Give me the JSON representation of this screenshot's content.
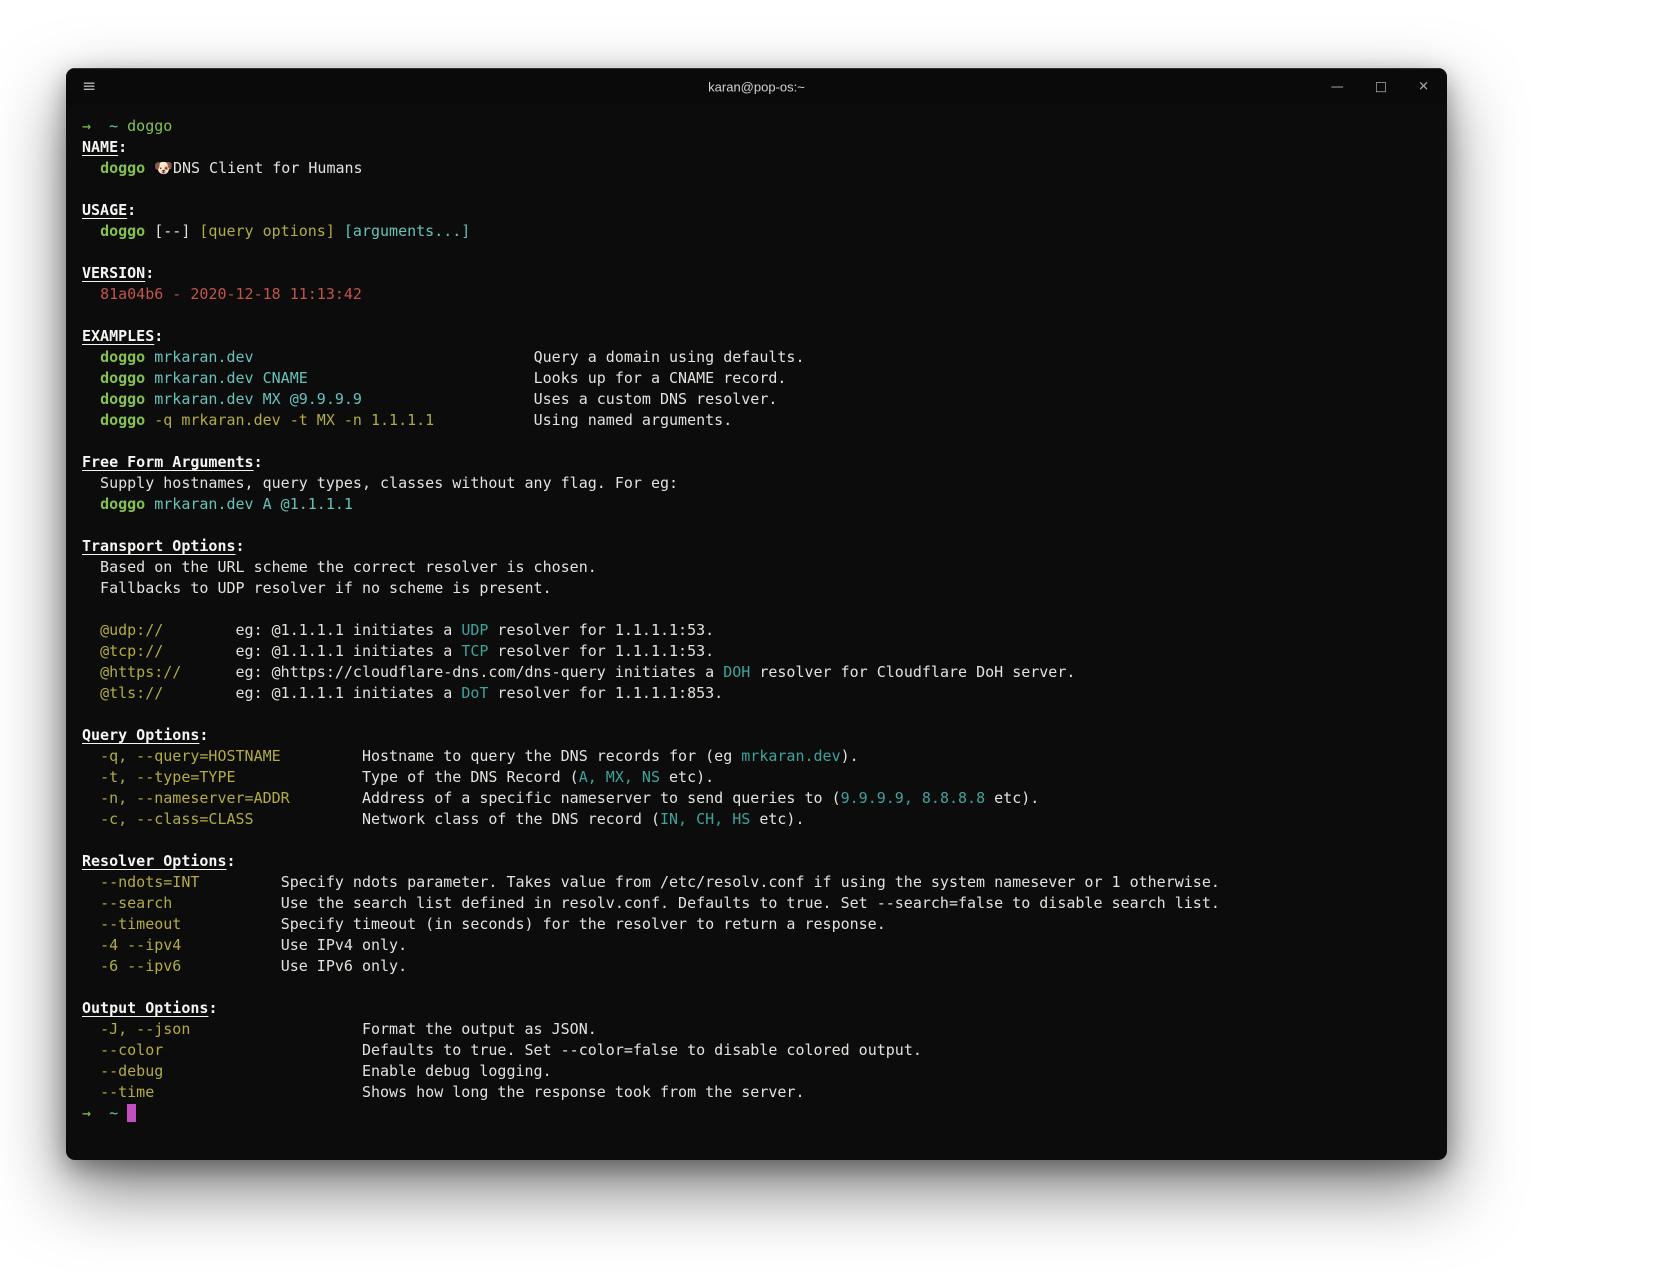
{
  "palette": {
    "bg": "#0b0c0b",
    "titlebar": "#0a0a0a",
    "g": "#84c052",
    "c": "#66c2bb",
    "t": "#3fa39b",
    "y": "#b3ac42",
    "r": "#c2544b",
    "w": "#e2e2de",
    "wb": "#f5f5f2",
    "cur": "#c050c0"
  },
  "window": {
    "title": "karan@pop-os:~",
    "menu_icon": "≡",
    "controls": {
      "minimize": "—",
      "maximize": "□",
      "close": "✕"
    }
  },
  "terminal": {
    "lines": [
      {
        "n": "prompt-line",
        "segs": [
          {
            "t": "→",
            "c": "g"
          },
          {
            "t": "  ",
            "c": "w"
          },
          {
            "t": "~",
            "c": "c"
          },
          {
            "t": " ",
            "c": "w"
          },
          {
            "t": "doggo",
            "c": "g"
          }
        ]
      },
      {
        "n": "name-header",
        "segs": [
          {
            "t": "NAME",
            "c": "h"
          },
          {
            "t": ":",
            "c": "wb"
          }
        ]
      },
      {
        "n": "name-value",
        "segs": [
          {
            "t": "  ",
            "c": "w"
          },
          {
            "t": "doggo",
            "c": "gb"
          },
          {
            "t": " 🐶",
            "c": "w"
          },
          {
            "t": "DNS Client for Humans",
            "c": "w"
          }
        ]
      },
      {
        "n": "blank-line",
        "segs": []
      },
      {
        "n": "usage-header",
        "segs": [
          {
            "t": "USAGE",
            "c": "h"
          },
          {
            "t": ":",
            "c": "wb"
          }
        ]
      },
      {
        "n": "usage-value",
        "segs": [
          {
            "t": "  ",
            "c": "w"
          },
          {
            "t": "doggo",
            "c": "gb"
          },
          {
            "t": " [--] ",
            "c": "w"
          },
          {
            "t": "[query options]",
            "c": "y"
          },
          {
            "t": " ",
            "c": "w"
          },
          {
            "t": "[arguments...]",
            "c": "c"
          }
        ]
      },
      {
        "n": "blank-line",
        "segs": []
      },
      {
        "n": "version-header",
        "segs": [
          {
            "t": "VERSION",
            "c": "h"
          },
          {
            "t": ":",
            "c": "wb"
          }
        ]
      },
      {
        "n": "version-value",
        "segs": [
          {
            "t": "  ",
            "c": "w"
          },
          {
            "t": "81a04b6 - 2020-12-18 11:13:42",
            "c": "r"
          }
        ]
      },
      {
        "n": "blank-line",
        "segs": []
      },
      {
        "n": "examples-header",
        "segs": [
          {
            "t": "EXAMPLES",
            "c": "h"
          },
          {
            "t": ":",
            "c": "wb"
          }
        ]
      },
      {
        "n": "example-row",
        "segs": [
          {
            "t": "  ",
            "c": "w"
          },
          {
            "t": "doggo",
            "c": "gb"
          },
          {
            "t": " ",
            "c": "w"
          },
          {
            "t": "mrkaran.dev",
            "c": "c"
          },
          {
            "t": "Query a domain using defaults.",
            "c": "w",
            "col": 50
          }
        ]
      },
      {
        "n": "example-row",
        "segs": [
          {
            "t": "  ",
            "c": "w"
          },
          {
            "t": "doggo",
            "c": "gb"
          },
          {
            "t": " ",
            "c": "w"
          },
          {
            "t": "mrkaran.dev CNAME",
            "c": "c"
          },
          {
            "t": "Looks up for a CNAME record.",
            "c": "w",
            "col": 50
          }
        ]
      },
      {
        "n": "example-row",
        "segs": [
          {
            "t": "  ",
            "c": "w"
          },
          {
            "t": "doggo",
            "c": "gb"
          },
          {
            "t": " ",
            "c": "w"
          },
          {
            "t": "mrkaran.dev MX @9.9.9.9",
            "c": "c"
          },
          {
            "t": "Uses a custom DNS resolver.",
            "c": "w",
            "col": 50
          }
        ]
      },
      {
        "n": "example-row",
        "segs": [
          {
            "t": "  ",
            "c": "w"
          },
          {
            "t": "doggo",
            "c": "gb"
          },
          {
            "t": " ",
            "c": "w"
          },
          {
            "t": "-q mrkaran.dev -t MX -n 1.1.1.1",
            "c": "y"
          },
          {
            "t": "Using named arguments.",
            "c": "w",
            "col": 50
          }
        ]
      },
      {
        "n": "blank-line",
        "segs": []
      },
      {
        "n": "freeform-header",
        "segs": [
          {
            "t": "Free Form Arguments",
            "c": "h"
          },
          {
            "t": ":",
            "c": "wb"
          }
        ]
      },
      {
        "n": "freeform-text",
        "segs": [
          {
            "t": "  Supply hostnames, query types, classes without any flag. For eg:",
            "c": "w"
          }
        ]
      },
      {
        "n": "freeform-example",
        "segs": [
          {
            "t": "  ",
            "c": "w"
          },
          {
            "t": "doggo",
            "c": "gb"
          },
          {
            "t": " ",
            "c": "w"
          },
          {
            "t": "mrkaran.dev A @1.1.1.1",
            "c": "c"
          }
        ]
      },
      {
        "n": "blank-line",
        "segs": []
      },
      {
        "n": "transport-header",
        "segs": [
          {
            "t": "Transport Options",
            "c": "h"
          },
          {
            "t": ":",
            "c": "wb"
          }
        ]
      },
      {
        "n": "transport-text",
        "segs": [
          {
            "t": "  Based on the URL scheme the correct resolver is chosen.",
            "c": "w"
          }
        ]
      },
      {
        "n": "transport-text",
        "segs": [
          {
            "t": "  Fallbacks to UDP resolver if no scheme is present.",
            "c": "w"
          }
        ]
      },
      {
        "n": "blank-line",
        "segs": []
      },
      {
        "n": "transport-row",
        "segs": [
          {
            "t": "  ",
            "c": "w"
          },
          {
            "t": "@udp://",
            "c": "y"
          },
          {
            "t": "eg: @1.1.1.1 initiates a ",
            "c": "w",
            "col": 17
          },
          {
            "t": "UDP",
            "c": "t"
          },
          {
            "t": " resolver for 1.1.1.1:53.",
            "c": "w"
          }
        ]
      },
      {
        "n": "transport-row",
        "segs": [
          {
            "t": "  ",
            "c": "w"
          },
          {
            "t": "@tcp://",
            "c": "y"
          },
          {
            "t": "eg: @1.1.1.1 initiates a ",
            "c": "w",
            "col": 17
          },
          {
            "t": "TCP",
            "c": "t"
          },
          {
            "t": " resolver for 1.1.1.1:53.",
            "c": "w"
          }
        ]
      },
      {
        "n": "transport-row",
        "segs": [
          {
            "t": "  ",
            "c": "w"
          },
          {
            "t": "@https://",
            "c": "y"
          },
          {
            "t": "eg: @https://cloudflare-dns.com/dns-query initiates a ",
            "c": "w",
            "col": 17
          },
          {
            "t": "DOH",
            "c": "t"
          },
          {
            "t": " resolver for Cloudflare DoH server.",
            "c": "w"
          }
        ]
      },
      {
        "n": "transport-row",
        "segs": [
          {
            "t": "  ",
            "c": "w"
          },
          {
            "t": "@tls://",
            "c": "y"
          },
          {
            "t": "eg: @1.1.1.1 initiates a ",
            "c": "w",
            "col": 17
          },
          {
            "t": "DoT",
            "c": "t"
          },
          {
            "t": " resolver for 1.1.1.1:853.",
            "c": "w"
          }
        ]
      },
      {
        "n": "blank-line",
        "segs": []
      },
      {
        "n": "query-header",
        "segs": [
          {
            "t": "Query Options",
            "c": "h"
          },
          {
            "t": ":",
            "c": "wb"
          }
        ]
      },
      {
        "n": "query-row",
        "segs": [
          {
            "t": "  ",
            "c": "w"
          },
          {
            "t": "-q, --query=HOSTNAME",
            "c": "y"
          },
          {
            "t": "Hostname to query the DNS records for (eg ",
            "c": "w",
            "col": 31
          },
          {
            "t": "mrkaran.dev",
            "c": "t"
          },
          {
            "t": ").",
            "c": "w"
          }
        ]
      },
      {
        "n": "query-row",
        "segs": [
          {
            "t": "  ",
            "c": "w"
          },
          {
            "t": "-t, --type=TYPE",
            "c": "y"
          },
          {
            "t": "Type of the DNS Record (",
            "c": "w",
            "col": 31
          },
          {
            "t": "A, MX, NS",
            "c": "t"
          },
          {
            "t": " etc).",
            "c": "w"
          }
        ]
      },
      {
        "n": "query-row",
        "segs": [
          {
            "t": "  ",
            "c": "w"
          },
          {
            "t": "-n, --nameserver=ADDR",
            "c": "y"
          },
          {
            "t": "Address of a specific nameserver to send queries to (",
            "c": "w",
            "col": 31
          },
          {
            "t": "9.9.9.9, 8.8.8.8",
            "c": "t"
          },
          {
            "t": " etc).",
            "c": "w"
          }
        ]
      },
      {
        "n": "query-row",
        "segs": [
          {
            "t": "  ",
            "c": "w"
          },
          {
            "t": "-c, --class=CLASS",
            "c": "y"
          },
          {
            "t": "Network class of the DNS record (",
            "c": "w",
            "col": 31
          },
          {
            "t": "IN, CH, HS",
            "c": "t"
          },
          {
            "t": " etc).",
            "c": "w"
          }
        ]
      },
      {
        "n": "blank-line",
        "segs": []
      },
      {
        "n": "resolver-header",
        "segs": [
          {
            "t": "Resolver Options",
            "c": "h"
          },
          {
            "t": ":",
            "c": "wb"
          }
        ]
      },
      {
        "n": "resolver-row",
        "segs": [
          {
            "t": "  ",
            "c": "w"
          },
          {
            "t": "--ndots=INT",
            "c": "y"
          },
          {
            "t": "Specify ndots parameter. Takes value from /etc/resolv.conf if using the system namesever or 1 otherwise.",
            "c": "w",
            "col": 22
          }
        ]
      },
      {
        "n": "resolver-row",
        "segs": [
          {
            "t": "  ",
            "c": "w"
          },
          {
            "t": "--search",
            "c": "y"
          },
          {
            "t": "Use the search list defined in resolv.conf. Defaults to true. Set --search=false to disable search list.",
            "c": "w",
            "col": 22
          }
        ]
      },
      {
        "n": "resolver-row",
        "segs": [
          {
            "t": "  ",
            "c": "w"
          },
          {
            "t": "--timeout",
            "c": "y"
          },
          {
            "t": "Specify timeout (in seconds) for the resolver to return a response.",
            "c": "w",
            "col": 22
          }
        ]
      },
      {
        "n": "resolver-row",
        "segs": [
          {
            "t": "  ",
            "c": "w"
          },
          {
            "t": "-4 --ipv4",
            "c": "y"
          },
          {
            "t": "Use IPv4 only.",
            "c": "w",
            "col": 22
          }
        ]
      },
      {
        "n": "resolver-row",
        "segs": [
          {
            "t": "  ",
            "c": "w"
          },
          {
            "t": "-6 --ipv6",
            "c": "y"
          },
          {
            "t": "Use IPv6 only.",
            "c": "w",
            "col": 22
          }
        ]
      },
      {
        "n": "blank-line",
        "segs": []
      },
      {
        "n": "output-header",
        "segs": [
          {
            "t": "Output Options",
            "c": "h"
          },
          {
            "t": ":",
            "c": "wb"
          }
        ]
      },
      {
        "n": "output-row",
        "segs": [
          {
            "t": "  ",
            "c": "w"
          },
          {
            "t": "-J, --json",
            "c": "y"
          },
          {
            "t": "Format the output as JSON.",
            "c": "w",
            "col": 31
          }
        ]
      },
      {
        "n": "output-row",
        "segs": [
          {
            "t": "  ",
            "c": "w"
          },
          {
            "t": "--color",
            "c": "y"
          },
          {
            "t": "Defaults to true. Set --color=false to disable colored output.",
            "c": "w",
            "col": 31
          }
        ]
      },
      {
        "n": "output-row",
        "segs": [
          {
            "t": "  ",
            "c": "w"
          },
          {
            "t": "--debug",
            "c": "y"
          },
          {
            "t": "Enable debug logging.",
            "c": "w",
            "col": 31
          }
        ]
      },
      {
        "n": "output-row",
        "segs": [
          {
            "t": "  ",
            "c": "w"
          },
          {
            "t": "--time",
            "c": "y"
          },
          {
            "t": "Shows how long the response took from the server.",
            "c": "w",
            "col": 31
          }
        ]
      },
      {
        "n": "prompt-line-cursor",
        "segs": [
          {
            "t": "→",
            "c": "g"
          },
          {
            "t": "  ",
            "c": "w"
          },
          {
            "t": "~",
            "c": "c"
          },
          {
            "t": " ",
            "c": "w"
          },
          {
            "t": " ",
            "c": "cur"
          }
        ]
      }
    ]
  }
}
